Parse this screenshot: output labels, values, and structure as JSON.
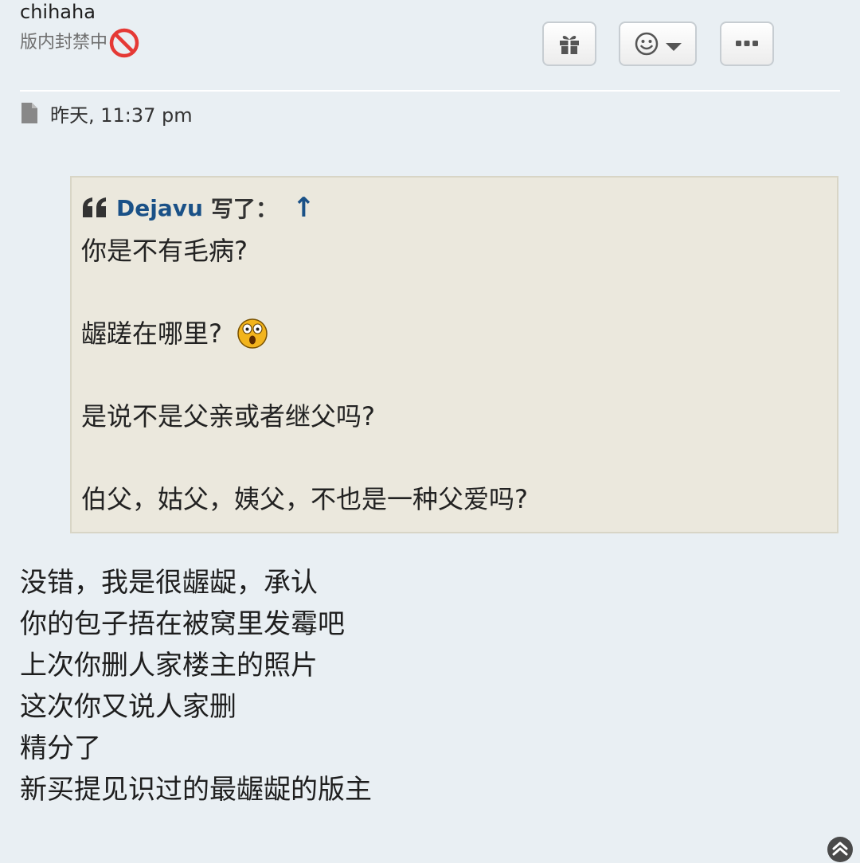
{
  "author": {
    "username": "chihaha",
    "rank": "版内封禁中",
    "rank_icon": "prohibited-icon"
  },
  "actions": {
    "gift_icon": "gift-icon",
    "react_icon": "smiley-icon",
    "react_caret_icon": "caret-down-icon",
    "more_icon": "ellipsis-icon"
  },
  "post": {
    "date_icon": "document-icon",
    "date": "昨天, 11:37 pm"
  },
  "quote": {
    "icon": "quote-icon",
    "author": "Dejavu",
    "wrote": "写了：",
    "jump": "↑",
    "lines": [
      "你是不有毛病?",
      "龌蹉在哪里?",
      "是说不是父亲或者继父吗?",
      "伯父，姑父，姨父，不也是一种父爱吗?"
    ],
    "emoji": "shocked-face-icon"
  },
  "reply": {
    "lines": [
      "没错，我是很龌龊，承认",
      "你的包子捂在被窝里发霉吧",
      "上次你删人家楼主的照片",
      "这次你又说人家删",
      "精分了",
      "新买提见识过的最龌龊的版主"
    ]
  },
  "scroll_top_icon": "chevron-up-circle-icon",
  "colors": {
    "background": "#e9eff3",
    "quote_bg": "#ebe8dd",
    "link": "#1a5187",
    "ban": "#e53935"
  }
}
